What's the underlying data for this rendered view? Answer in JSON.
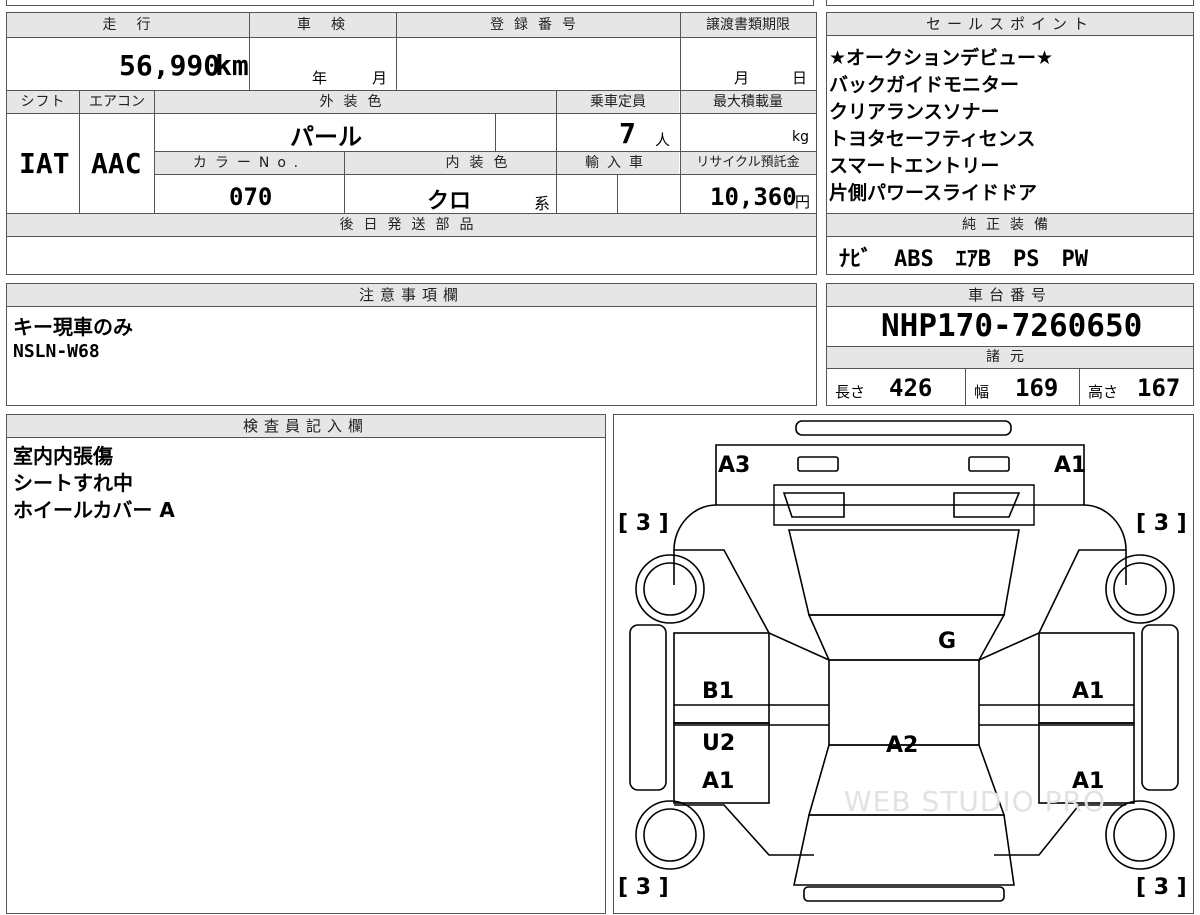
{
  "mileage": {
    "label": "走　行",
    "value": "56,990",
    "unit": "km"
  },
  "shaken": {
    "label": "車　検",
    "year_unit": "年",
    "month_unit": "月"
  },
  "registration": {
    "label": "登録番号"
  },
  "transfer": {
    "label": "譲渡書類期限",
    "month_unit": "月",
    "day_unit": "日"
  },
  "shift": {
    "label": "シフト",
    "value": "IAT"
  },
  "aircon": {
    "label": "エアコン",
    "value": "AAC"
  },
  "exterior_color": {
    "label": "外装色",
    "value": "パール"
  },
  "capacity": {
    "label": "乗車定員",
    "value": "7",
    "unit": "人"
  },
  "max_load": {
    "label": "最大積載量",
    "unit": "kg"
  },
  "color_no": {
    "label": "カラーNo.",
    "value": "070"
  },
  "interior_color": {
    "label": "内装色",
    "value": "クロ",
    "suffix": "系"
  },
  "import": {
    "label": "輸入車"
  },
  "recycle": {
    "label": "リサイクル預託金",
    "value": "10,360",
    "unit": "円"
  },
  "later_parts": {
    "label": "後日発送部品"
  },
  "sales_points": {
    "label": "セールスポイント",
    "items": [
      "★オークションデビュー★",
      "バックガイドモニター",
      "クリアランスソナー",
      "トヨタセーフティセンス",
      "スマートエントリー",
      "片側パワースライドドア"
    ]
  },
  "genuine_equipment": {
    "label": "純正装備",
    "value": "ﾅﾋﾞ　ABS　ｴｱB　PS　PW"
  },
  "notes": {
    "label": "注意事項欄",
    "lines": [
      "キー現車のみ",
      "NSLN-W68"
    ]
  },
  "chassis": {
    "label": "車台番号",
    "value": "NHP170-7260650"
  },
  "specs": {
    "label": "諸元",
    "length_label": "長さ",
    "length": "426",
    "width_label": "幅",
    "width": "169",
    "height_label": "高さ",
    "height": "167"
  },
  "inspector": {
    "label": "検査員記入欄",
    "lines": [
      "室内内張傷",
      "シートすれ中",
      "ホイールカバー A"
    ]
  },
  "diagram": {
    "labels": {
      "rear_left": "A3",
      "rear_right": "A1",
      "tire_fl": "[ 3 ]",
      "tire_fr": "[ 3 ]",
      "tire_rl": "[ 3 ]",
      "tire_rr": "[ 3 ]",
      "windshield": "G",
      "front_door_l": "B1",
      "front_door_r": "A1",
      "rear_door_l_1": "U2",
      "rear_door_l_2": "A1",
      "rear_door_r": "A1",
      "roof": "A2"
    },
    "watermark": "WEB STUDIO PRO"
  }
}
